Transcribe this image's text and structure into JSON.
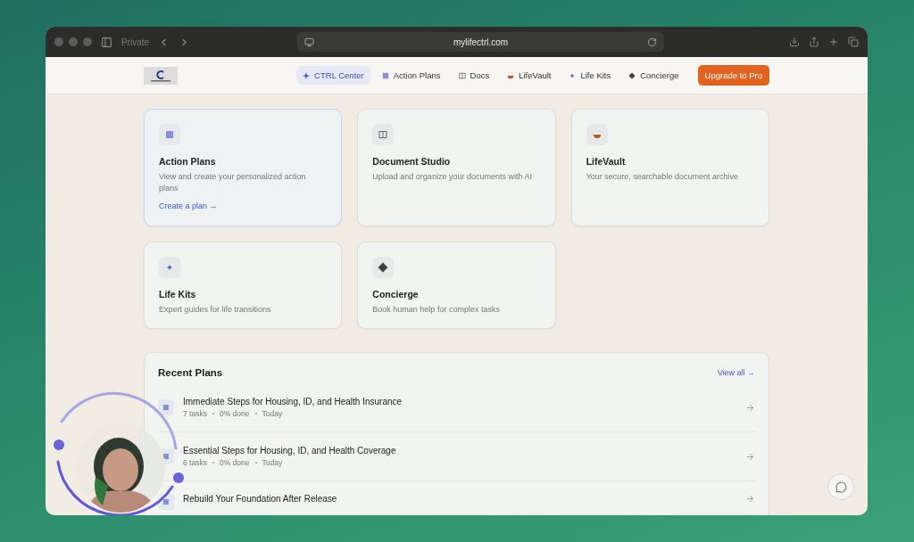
{
  "browser": {
    "tab_label": "Private",
    "url": "mylifectrl.com"
  },
  "nav": {
    "items": [
      {
        "label": "CTRL Center",
        "selected": true
      },
      {
        "label": "Action Plans",
        "selected": false
      },
      {
        "label": "Docs",
        "selected": false
      },
      {
        "label": "LifeVault",
        "selected": false
      },
      {
        "label": "Life Kits",
        "selected": false
      },
      {
        "label": "Concierge",
        "selected": false
      }
    ],
    "upgrade_button": "Upgrade to Pro"
  },
  "cards": [
    {
      "title": "Action Plans",
      "description": "View and create your personalized action plans",
      "link": "Create a plan →",
      "highlighted": true
    },
    {
      "title": "Document Studio",
      "description": "Upload and organize your documents with AI",
      "highlighted": false
    },
    {
      "title": "LifeVault",
      "description": "Your secure, searchable document archive",
      "highlighted": false
    },
    {
      "title": "Life Kits",
      "description": "Expert guides for life transitions",
      "highlighted": false
    },
    {
      "title": "Concierge",
      "description": "Book human help for complex tasks",
      "highlighted": false
    }
  ],
  "recent_plans": {
    "title": "Recent Plans",
    "view_all": "View all →",
    "plans": [
      {
        "title": "Immediate Steps for Housing, ID, and Health Insurance",
        "meta": [
          "7 tasks",
          "0% done",
          "Today"
        ]
      },
      {
        "title": "Essential Steps for Housing, ID, and Health Coverage",
        "meta": [
          "6 tasks",
          "0% done",
          "Today"
        ]
      },
      {
        "title": "Rebuild Your Foundation After Release"
      }
    ]
  }
}
